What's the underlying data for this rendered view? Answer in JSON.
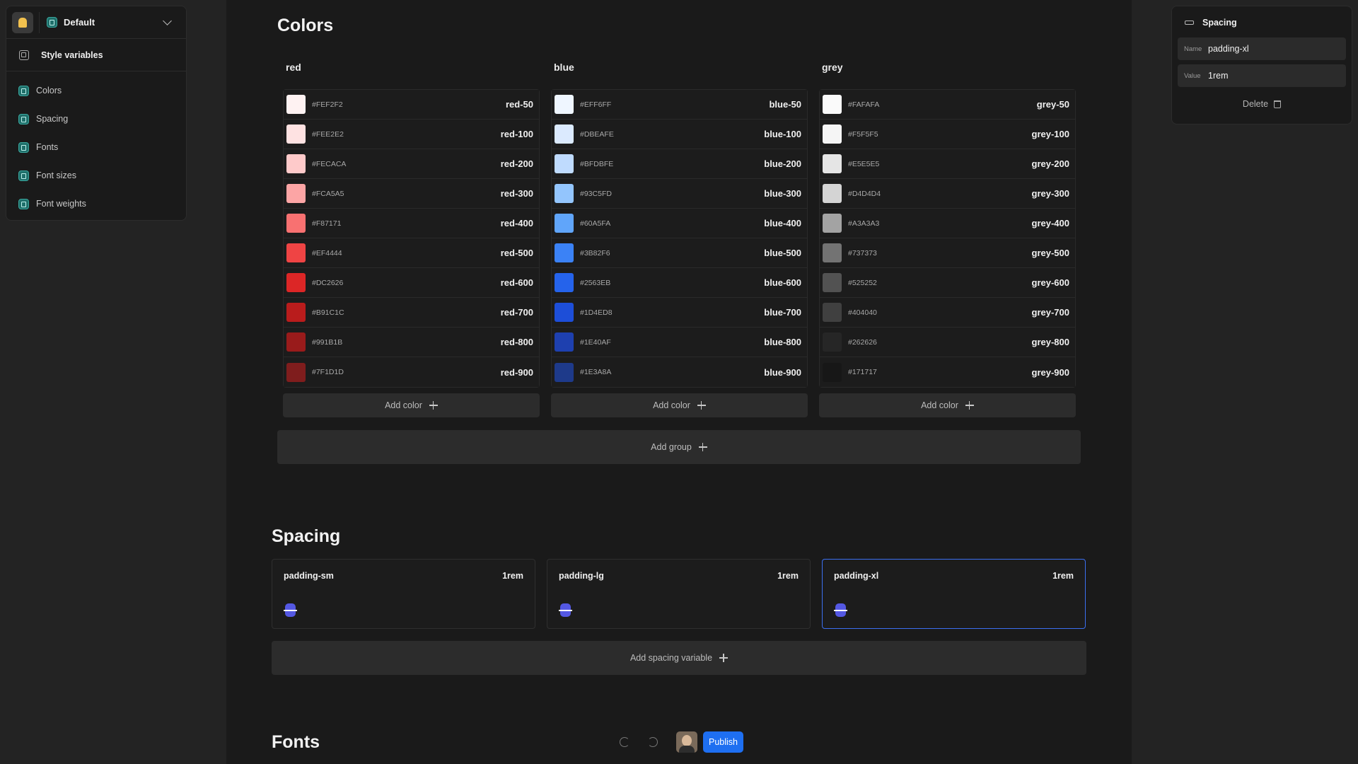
{
  "project": {
    "name": "Default"
  },
  "sidebar": {
    "header": "Style variables",
    "items": [
      {
        "label": "Colors"
      },
      {
        "label": "Spacing"
      },
      {
        "label": "Fonts"
      },
      {
        "label": "Font sizes"
      },
      {
        "label": "Font weights"
      }
    ]
  },
  "inspector": {
    "title": "Spacing",
    "name_label": "Name",
    "name_value": "padding-xl",
    "value_label": "Value",
    "value_value": "1rem",
    "delete_label": "Delete"
  },
  "colors": {
    "title": "Colors",
    "add_color_label": "Add color",
    "add_group_label": "Add group",
    "groups": [
      {
        "name": "red",
        "swatches": [
          {
            "hex": "#FEF2F2",
            "token": "red-50"
          },
          {
            "hex": "#FEE2E2",
            "token": "red-100"
          },
          {
            "hex": "#FECACA",
            "token": "red-200"
          },
          {
            "hex": "#FCA5A5",
            "token": "red-300"
          },
          {
            "hex": "#F87171",
            "token": "red-400"
          },
          {
            "hex": "#EF4444",
            "token": "red-500"
          },
          {
            "hex": "#DC2626",
            "token": "red-600"
          },
          {
            "hex": "#B91C1C",
            "token": "red-700"
          },
          {
            "hex": "#991B1B",
            "token": "red-800"
          },
          {
            "hex": "#7F1D1D",
            "token": "red-900"
          }
        ]
      },
      {
        "name": "blue",
        "swatches": [
          {
            "hex": "#EFF6FF",
            "token": "blue-50"
          },
          {
            "hex": "#DBEAFE",
            "token": "blue-100"
          },
          {
            "hex": "#BFDBFE",
            "token": "blue-200"
          },
          {
            "hex": "#93C5FD",
            "token": "blue-300"
          },
          {
            "hex": "#60A5FA",
            "token": "blue-400"
          },
          {
            "hex": "#3B82F6",
            "token": "blue-500"
          },
          {
            "hex": "#2563EB",
            "token": "blue-600"
          },
          {
            "hex": "#1D4ED8",
            "token": "blue-700"
          },
          {
            "hex": "#1E40AF",
            "token": "blue-800"
          },
          {
            "hex": "#1E3A8A",
            "token": "blue-900"
          }
        ]
      },
      {
        "name": "grey",
        "swatches": [
          {
            "hex": "#FAFAFA",
            "token": "grey-50"
          },
          {
            "hex": "#F5F5F5",
            "token": "grey-100"
          },
          {
            "hex": "#E5E5E5",
            "token": "grey-200"
          },
          {
            "hex": "#D4D4D4",
            "token": "grey-300"
          },
          {
            "hex": "#A3A3A3",
            "token": "grey-400"
          },
          {
            "hex": "#737373",
            "token": "grey-500"
          },
          {
            "hex": "#525252",
            "token": "grey-600"
          },
          {
            "hex": "#404040",
            "token": "grey-700"
          },
          {
            "hex": "#262626",
            "token": "grey-800"
          },
          {
            "hex": "#171717",
            "token": "grey-900"
          }
        ]
      }
    ]
  },
  "spacing": {
    "title": "Spacing",
    "add_label": "Add spacing variable",
    "cards": [
      {
        "name": "padding-sm",
        "value": "1rem"
      },
      {
        "name": "padding-lg",
        "value": "1rem"
      },
      {
        "name": "padding-xl",
        "value": "1rem",
        "selected": true
      }
    ]
  },
  "fonts": {
    "title": "Fonts"
  },
  "toolbar": {
    "publish_label": "Publish"
  }
}
